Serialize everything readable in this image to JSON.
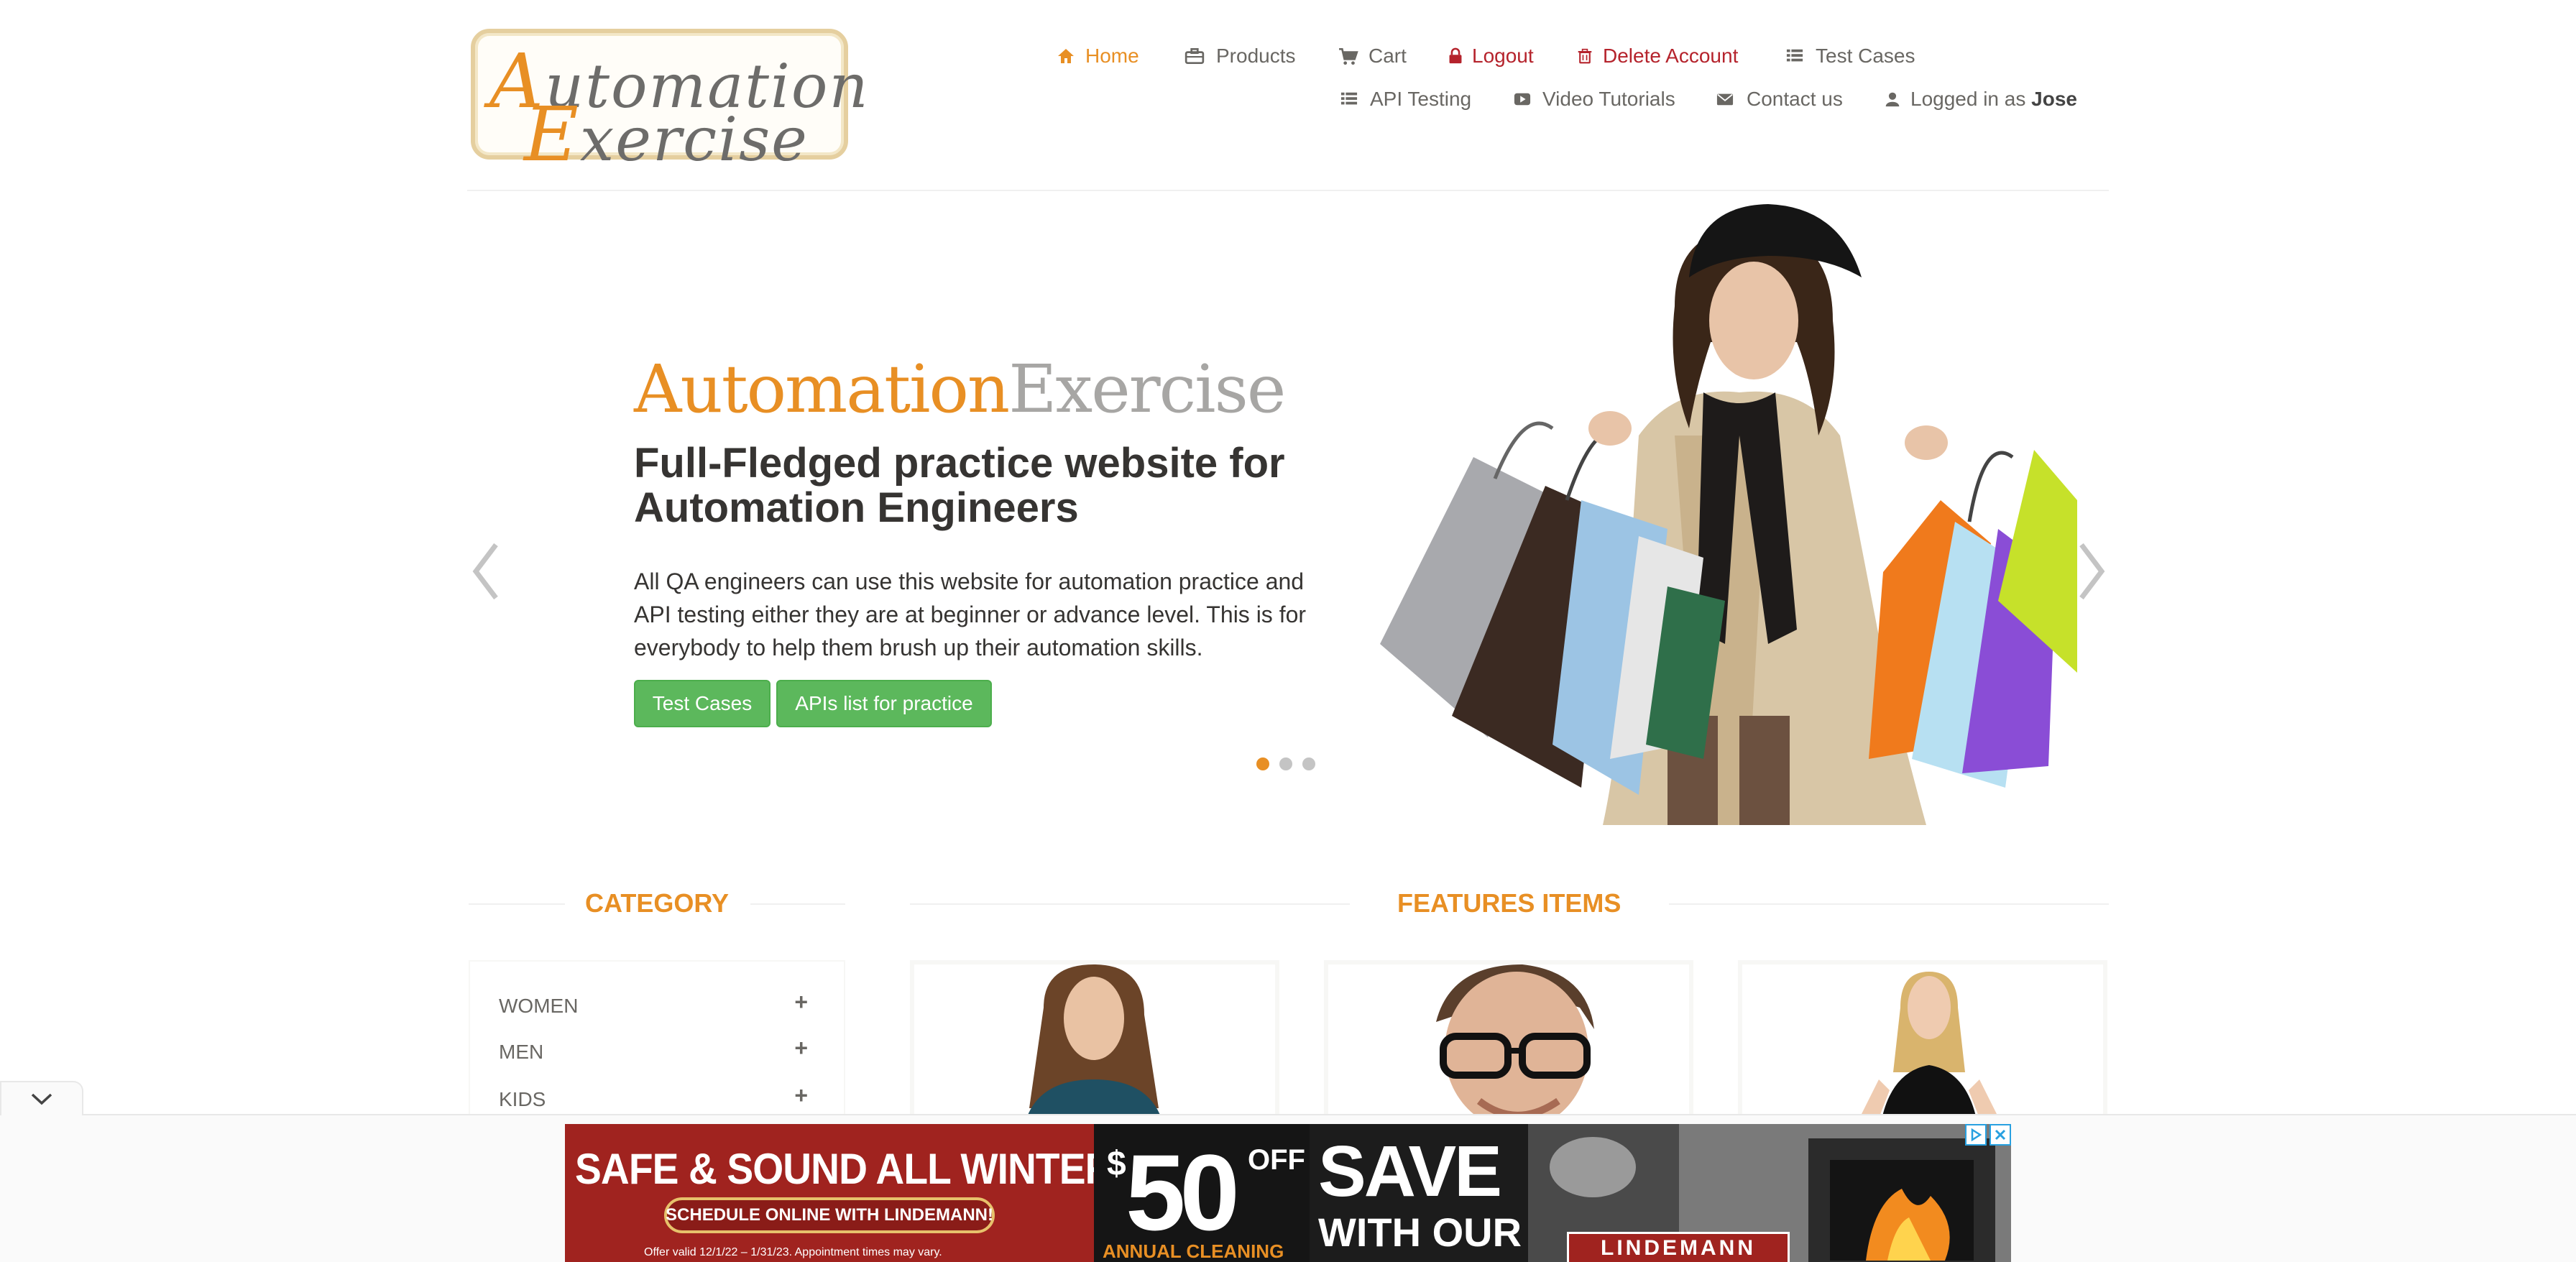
{
  "logo": {
    "line1_cap": "A",
    "line1_rest": "utomation",
    "line2_cap": "E",
    "line2_rest": "xercise"
  },
  "nav": {
    "home": "Home",
    "products": "Products",
    "cart": "Cart",
    "logout": "Logout",
    "delete_account": "Delete Account",
    "test_cases": "Test Cases",
    "api_testing": "API Testing",
    "video_tutorials": "Video Tutorials",
    "contact_us": "Contact us",
    "logged_in_prefix": "Logged in as",
    "logged_in_user": "Jose"
  },
  "slider": {
    "brand_a": "Automation",
    "brand_b": "Exercise",
    "title": "Full-Fledged practice website for Automation Engineers",
    "description": "All QA engineers can use this website for automation practice and API testing either they are at beginner or advance level. This is for everybody to help them brush up their automation skills.",
    "btn_test_cases": "Test Cases",
    "btn_apis": "APIs list for practice",
    "active_slide": 1,
    "slide_count": 3
  },
  "category": {
    "title": "CATEGORY",
    "items": [
      {
        "label": "WOMEN",
        "expand": "+"
      },
      {
        "label": "MEN",
        "expand": "+"
      },
      {
        "label": "KIDS",
        "expand": "+"
      }
    ]
  },
  "features": {
    "title": "FEATURES ITEMS"
  },
  "ad": {
    "headline": "SAFE & SOUND ALL WINTER",
    "schedule": "SCHEDULE ONLINE WITH LINDEMANN!",
    "fine_print": "Offer valid 12/1/22 – 1/31/23. Appointment times may vary.",
    "dollar": "$",
    "amount": "50",
    "off": "OFF",
    "annual": "ANNUAL CLEANING",
    "save": "SAVE",
    "with_our": "WITH OUR",
    "brand": "LINDEMANN"
  },
  "colors": {
    "accent": "#e88f24",
    "danger": "#b5232c",
    "green": "#5cb85c"
  }
}
